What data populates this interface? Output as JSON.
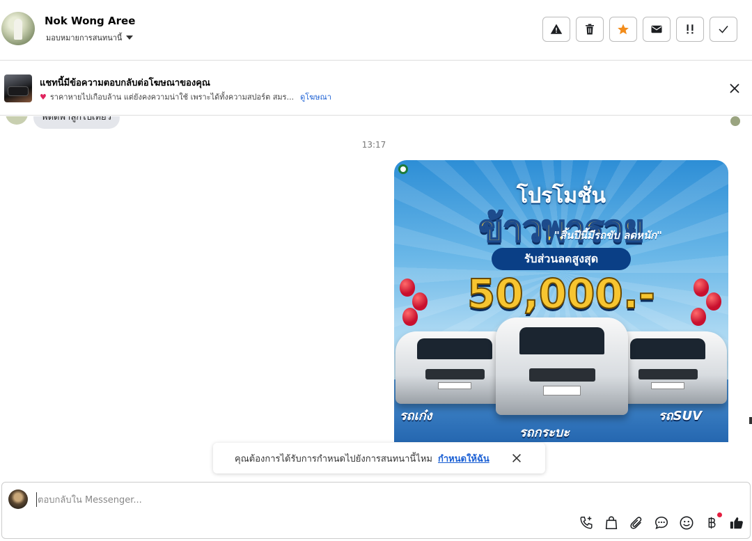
{
  "header": {
    "contact_name": "Nok Wong Aree",
    "assign_label": "มอบหมายการสนทนานี้"
  },
  "ad_reply": {
    "title": "แชทนี้มีข้อความตอบกลับต่อโฆษณาของคุณ",
    "snippet": "ราคาหายไปเกือบล้าน แต่ยังคงความน่าใช้ เพราะได้ทั้งความสปอร์ต สมร...",
    "view_ad_link": "ดูโฆษณา"
  },
  "chat": {
    "partial_message": "พี่ตัดพาลูกไปเที่ยว",
    "timestamp": "13:17"
  },
  "promo_image": {
    "title_line1": "โปรโมชั่น",
    "title_line2": "ข้าวพารวย",
    "tagline": "\"สิ้นปีนี้มีรถขับ ลดหนัก\"",
    "discount_label": "รับส่วนลดสูงสุด",
    "amount": "50,000.-",
    "label_sedan": "รถเก๋ง",
    "label_pickup": "รถกระบะ",
    "label_suv": "รถSUV"
  },
  "toast": {
    "text": "คุณต้องการได้รับการกำหนดไปยังการสนทนานี้ไหม",
    "action_link": "กำหนดให้ฉัน"
  },
  "composer": {
    "placeholder": "ตอบกลับใน Messenger..."
  },
  "colors": {
    "link": "#1a5fd4",
    "star": "#f28c1b",
    "notification_dot": "#e41e3f"
  }
}
